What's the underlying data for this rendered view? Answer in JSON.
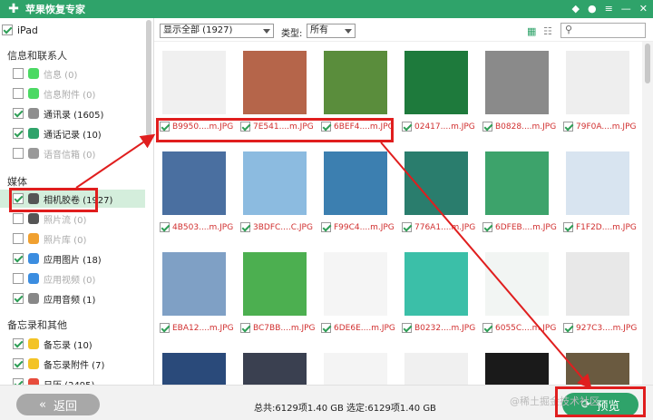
{
  "app": {
    "title": "苹果恢复专家"
  },
  "sidebar": {
    "device": "iPad",
    "section1": "信息和联系人",
    "items1": [
      {
        "label": "信息 (0)",
        "checked": false,
        "disabled": true,
        "color": "#4cd964"
      },
      {
        "label": "信息附件 (0)",
        "checked": false,
        "disabled": true,
        "color": "#4cd964"
      },
      {
        "label": "通讯录 (1605)",
        "checked": true,
        "disabled": false,
        "color": "#8e8e8e"
      },
      {
        "label": "通话记录 (10)",
        "checked": true,
        "disabled": false,
        "color": "#2fa36a"
      },
      {
        "label": "语音信箱 (0)",
        "checked": false,
        "disabled": true,
        "color": "#999999"
      }
    ],
    "section2": "媒体",
    "items2": [
      {
        "label": "相机胶卷 (1927)",
        "checked": true,
        "disabled": false,
        "color": "#555555"
      },
      {
        "label": "照片流 (0)",
        "checked": false,
        "disabled": true,
        "color": "#555555"
      },
      {
        "label": "照片库 (0)",
        "checked": false,
        "disabled": true,
        "color": "#f0a030"
      },
      {
        "label": "应用图片 (18)",
        "checked": true,
        "disabled": false,
        "color": "#3b8de0"
      },
      {
        "label": "应用视频 (0)",
        "checked": false,
        "disabled": true,
        "color": "#3b8de0"
      },
      {
        "label": "应用音频 (1)",
        "checked": true,
        "disabled": false,
        "color": "#888888"
      }
    ],
    "section3": "备忘录和其他",
    "items3": [
      {
        "label": "备忘录 (10)",
        "checked": true,
        "disabled": false,
        "color": "#f3c325"
      },
      {
        "label": "备忘录附件 (7)",
        "checked": true,
        "disabled": false,
        "color": "#f3c325"
      },
      {
        "label": "日历 (2495)",
        "checked": true,
        "disabled": false,
        "color": "#e74c3c"
      }
    ]
  },
  "toolbar": {
    "filter": "显示全部 (1927)",
    "type_label": "类型:",
    "type_value": "所有"
  },
  "files": [
    {
      "name": "B9950....m.JPG",
      "color": "#f0f0f0"
    },
    {
      "name": "7E541....m.JPG",
      "color": "#b5654a"
    },
    {
      "name": "6BEF4....m.JPG",
      "color": "#5a8d3c"
    },
    {
      "name": "02417....m.JPG",
      "color": "#1e7a3c"
    },
    {
      "name": "B0828....m.JPG",
      "color": "#8a8a8a"
    },
    {
      "name": "79F0A....m.JPG",
      "color": "#eeeeee"
    },
    {
      "name": "4B503....m.JPG",
      "color": "#4a6fa0"
    },
    {
      "name": "3BDFC....C.JPG",
      "color": "#8cbbe0"
    },
    {
      "name": "F99C4....m.JPG",
      "color": "#3c7fb0"
    },
    {
      "name": "776A1....m.JPG",
      "color": "#2a7d6d"
    },
    {
      "name": "6DFEB....m.JPG",
      "color": "#3da36b"
    },
    {
      "name": "F1F2D....m.JPG",
      "color": "#d8e4f0"
    },
    {
      "name": "EBA12....m.JPG",
      "color": "#7fa0c5"
    },
    {
      "name": "BC7BB....m.JPG",
      "color": "#4caf50"
    },
    {
      "name": "6DE6E....m.JPG",
      "color": "#f5f5f5"
    },
    {
      "name": "B0232....m.JPG",
      "color": "#3bbfa8"
    },
    {
      "name": "6055C....m.JPG",
      "color": "#f2f5f3"
    },
    {
      "name": "927C3....m.JPG",
      "color": "#e8e8e8"
    },
    {
      "name": "",
      "color": "#2a4a7a"
    },
    {
      "name": "",
      "color": "#3a4050"
    },
    {
      "name": "",
      "color": "#f4f4f4"
    },
    {
      "name": "",
      "color": "#f0f0f0"
    },
    {
      "name": "",
      "color": "#1a1a1a"
    },
    {
      "name": "",
      "color": "#6a5a40"
    }
  ],
  "footer": {
    "back": "返回",
    "status": "总共:6129项1.40 GB 选定:6129项1.40 GB",
    "preview": "预览",
    "watermark": "@稀土掘金技术社区"
  }
}
